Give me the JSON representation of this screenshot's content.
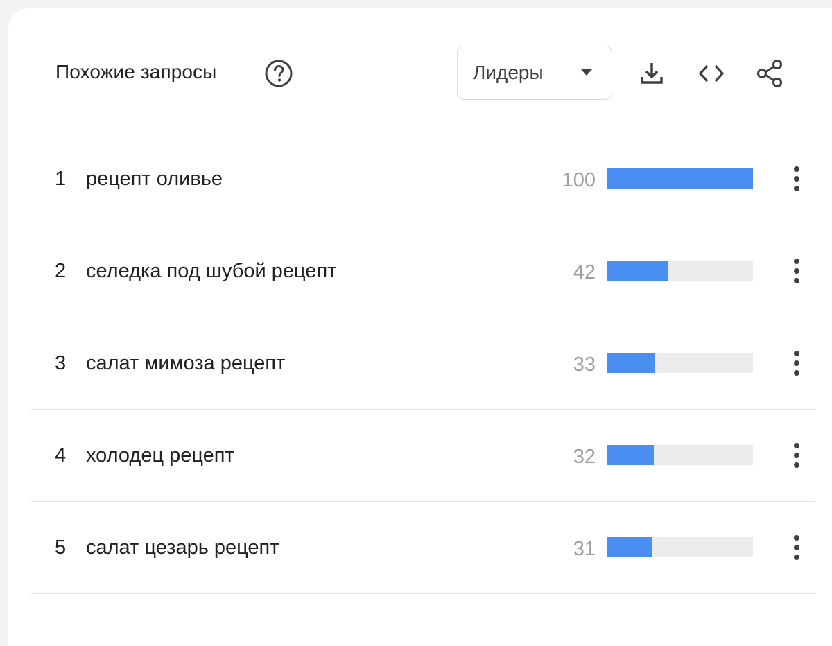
{
  "header": {
    "title": "Похожие запросы",
    "help_icon": "help-circle-icon",
    "dropdown": {
      "selected": "Лидеры"
    },
    "icons": [
      "download-icon",
      "embed-code-icon",
      "share-icon"
    ]
  },
  "chart_data": {
    "type": "bar",
    "categories": [
      "рецепт оливье",
      "селедка под шубой рецепт",
      "салат мимоза рецепт",
      "холодец рецепт",
      "салат цезарь рецепт"
    ],
    "values": [
      100,
      42,
      33,
      32,
      31
    ],
    "ylim": [
      0,
      100
    ],
    "bar_color": "#4a8ef1",
    "track_color": "#ececec"
  },
  "rows": [
    {
      "rank": "1",
      "query": "рецепт оливье",
      "value": "100"
    },
    {
      "rank": "2",
      "query": "селедка под шубой рецепт",
      "value": "42"
    },
    {
      "rank": "3",
      "query": "салат мимоза рецепт",
      "value": "33"
    },
    {
      "rank": "4",
      "query": "холодец рецепт",
      "value": "32"
    },
    {
      "rank": "5",
      "query": "салат цезарь рецепт",
      "value": "31"
    }
  ]
}
